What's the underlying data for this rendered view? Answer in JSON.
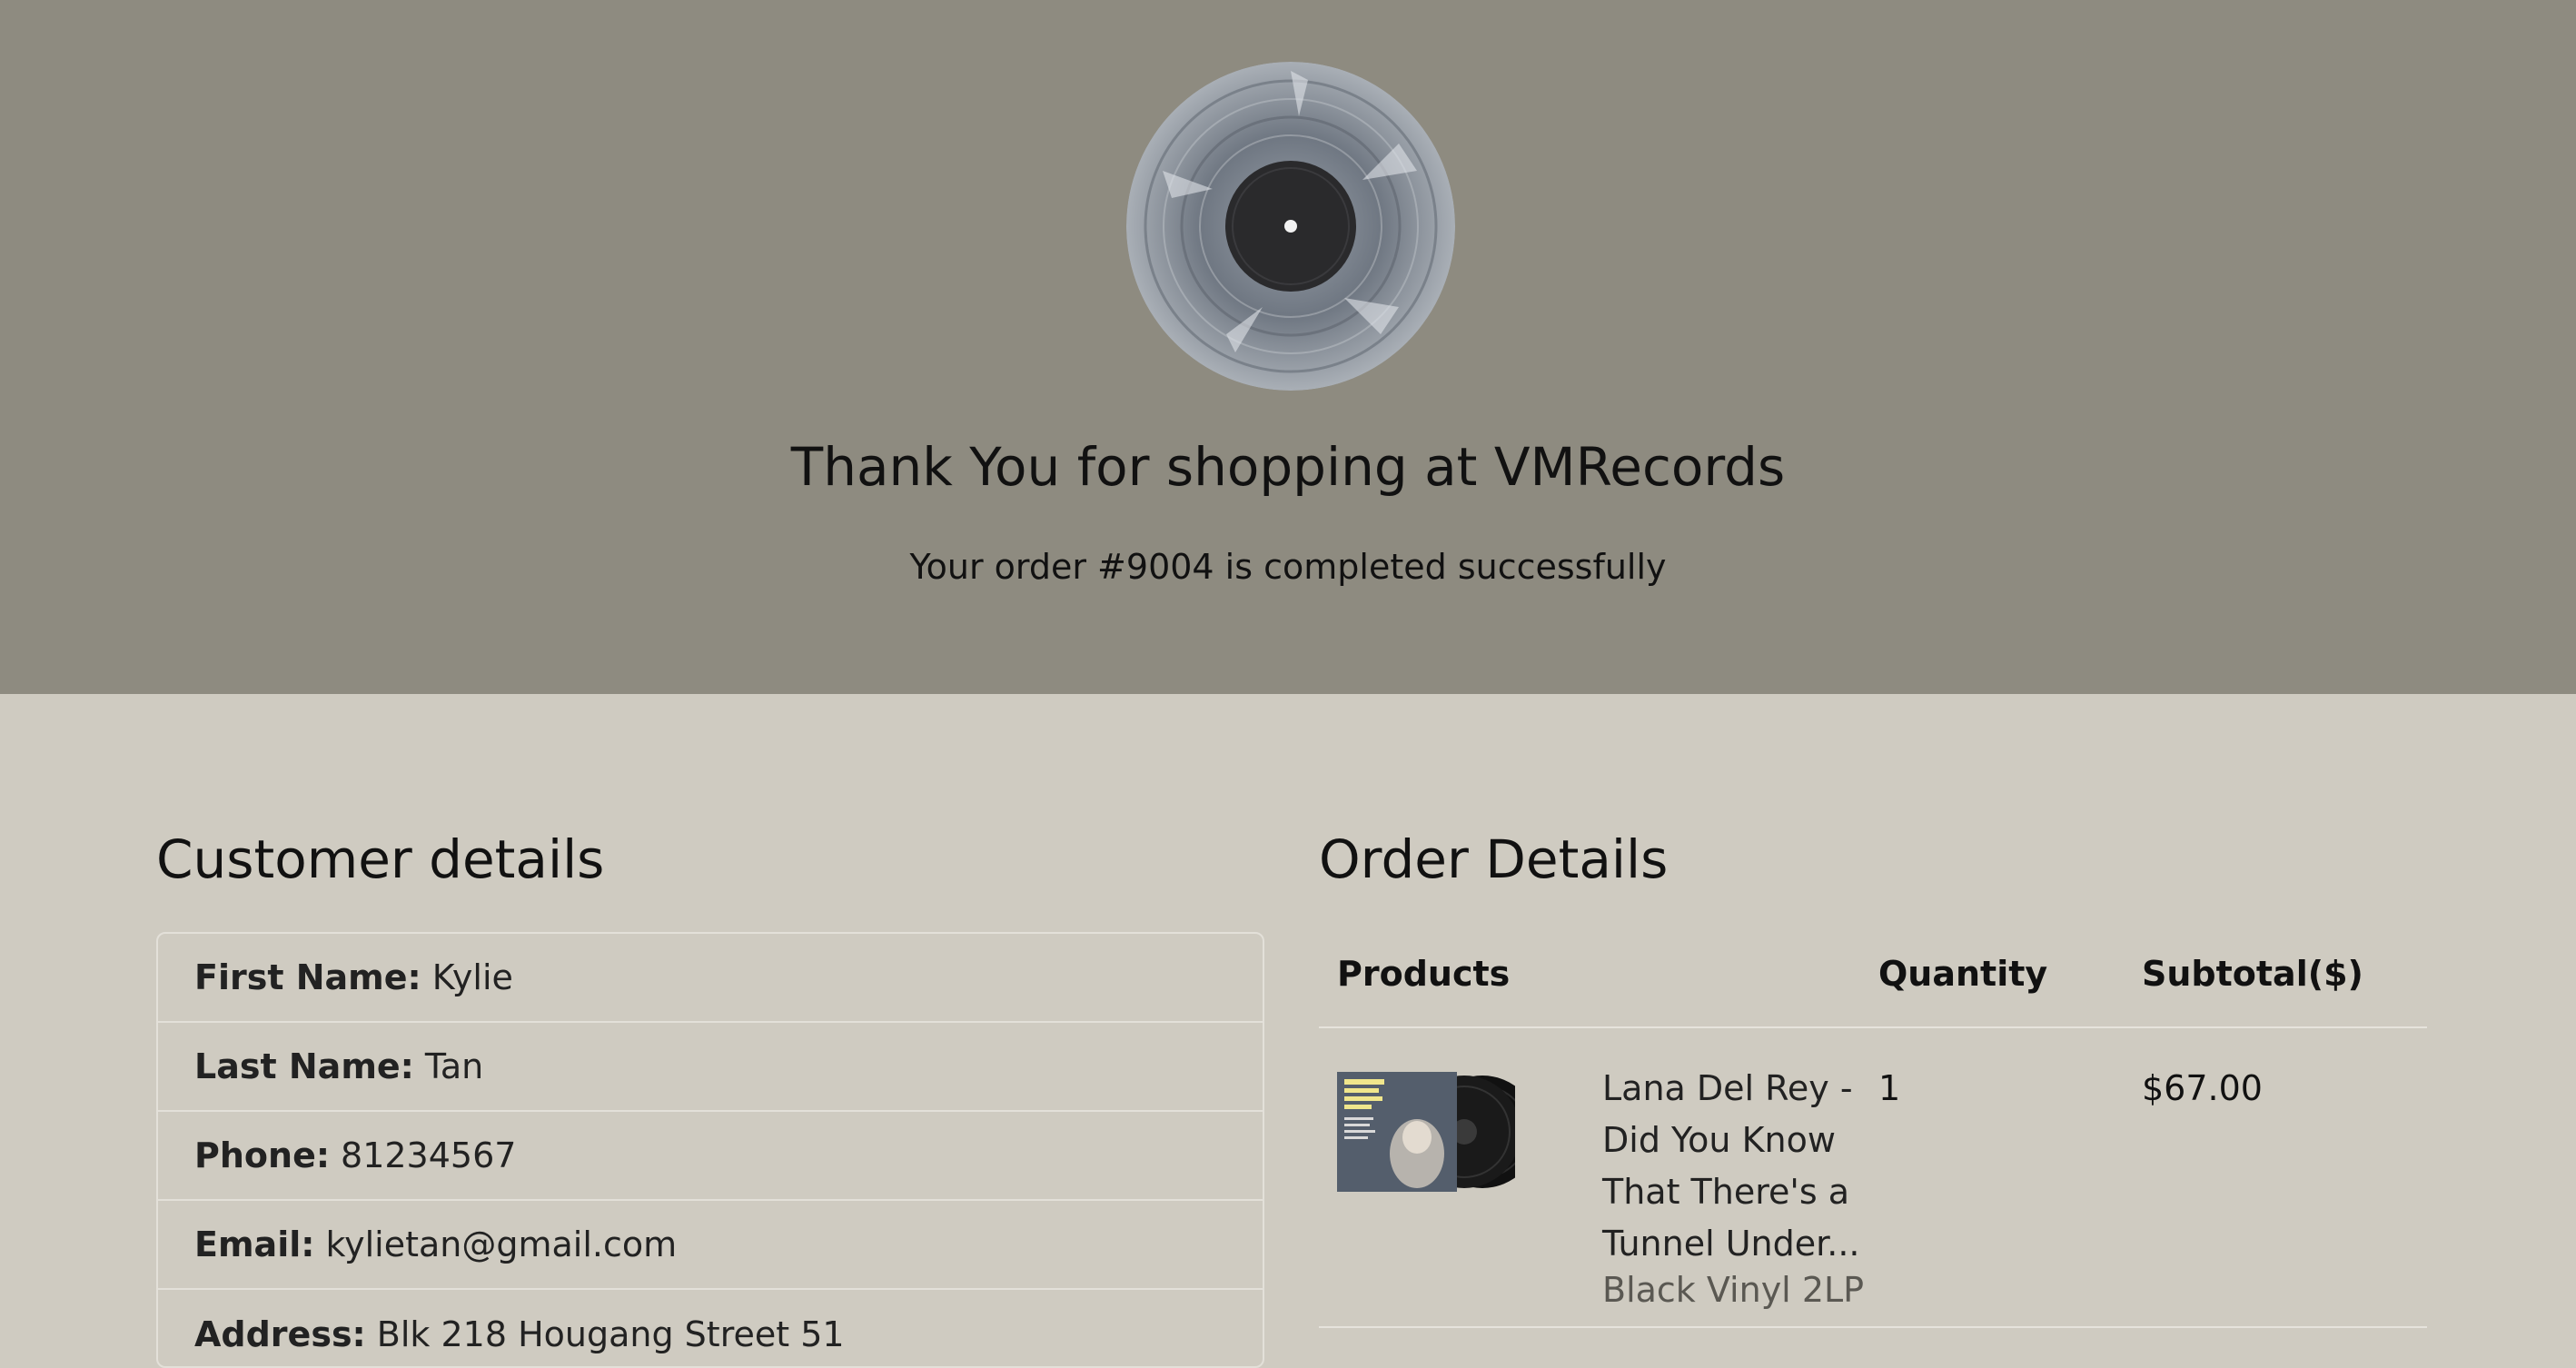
{
  "hero": {
    "title": "Thank You for shopping at VMRecords",
    "subtitle": "Your order #9004 is completed successfully",
    "background": "#8e8b80",
    "image_icon": "vinyl-record-image"
  },
  "customer": {
    "heading": "Customer details",
    "fields": [
      {
        "label": "First Name:",
        "value": "Kylie"
      },
      {
        "label": "Last Name:",
        "value": "Tan"
      },
      {
        "label": "Phone:",
        "value": "81234567"
      },
      {
        "label": "Email:",
        "value": "kylietan@gmail.com"
      },
      {
        "label": "Address:",
        "value": "Blk 218 Hougang Street 51"
      }
    ]
  },
  "order": {
    "heading": "Order Details",
    "columns": {
      "product": "Products",
      "quantity": "Quantity",
      "subtotal": "Subtotal($)"
    },
    "items": [
      {
        "name": "Lana Del Rey - Did You Know That There's a Tunnel Under...",
        "variant": "Black Vinyl 2LP",
        "quantity": "1",
        "subtotal": "$67.00",
        "thumbnail_icon": "album-cover-thumbnail"
      }
    ]
  },
  "colors": {
    "page_background": "#cfcbc1",
    "hero_background": "#8e8b80",
    "divider": "#e3e0d9"
  }
}
